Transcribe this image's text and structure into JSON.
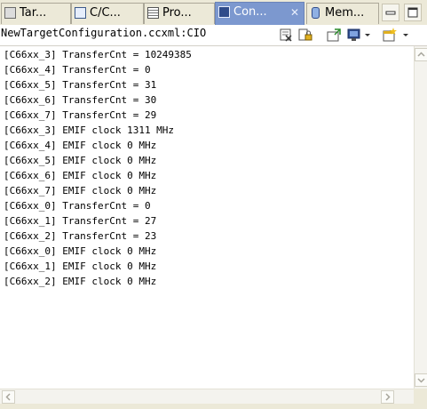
{
  "tabs": [
    {
      "label": "Tar...",
      "icon": "target-icon"
    },
    {
      "label": "C/C...",
      "icon": "cpp-project-icon"
    },
    {
      "label": "Pro...",
      "icon": "properties-icon"
    },
    {
      "label": "Con...",
      "icon": "console-icon",
      "active": true,
      "close": "✕"
    },
    {
      "label": "Mem...",
      "icon": "memory-icon"
    }
  ],
  "console": {
    "title": "NewTargetConfiguration.ccxml:CIO",
    "lines": [
      "[C66xx_3] TransferCnt = 10249385",
      "[C66xx_4] TransferCnt = 0",
      "[C66xx_5] TransferCnt = 31",
      "[C66xx_6] TransferCnt = 30",
      "[C66xx_7] TransferCnt = 29",
      "[C66xx_3] EMIF clock 1311 MHz",
      "[C66xx_4] EMIF clock 0 MHz",
      "[C66xx_5] EMIF clock 0 MHz",
      "[C66xx_6] EMIF clock 0 MHz",
      "[C66xx_7] EMIF clock 0 MHz",
      "[C66xx_0] TransferCnt = 0",
      "[C66xx_1] TransferCnt = 27",
      "[C66xx_2] TransferCnt = 23",
      "[C66xx_0] EMIF clock 0 MHz",
      "[C66xx_1] EMIF clock 0 MHz",
      "[C66xx_2] EMIF clock 0 MHz"
    ]
  },
  "colors": {
    "active_tab": "#7c98cf",
    "console_bg": "#ffffff",
    "chrome_bg": "#ece9d8"
  }
}
